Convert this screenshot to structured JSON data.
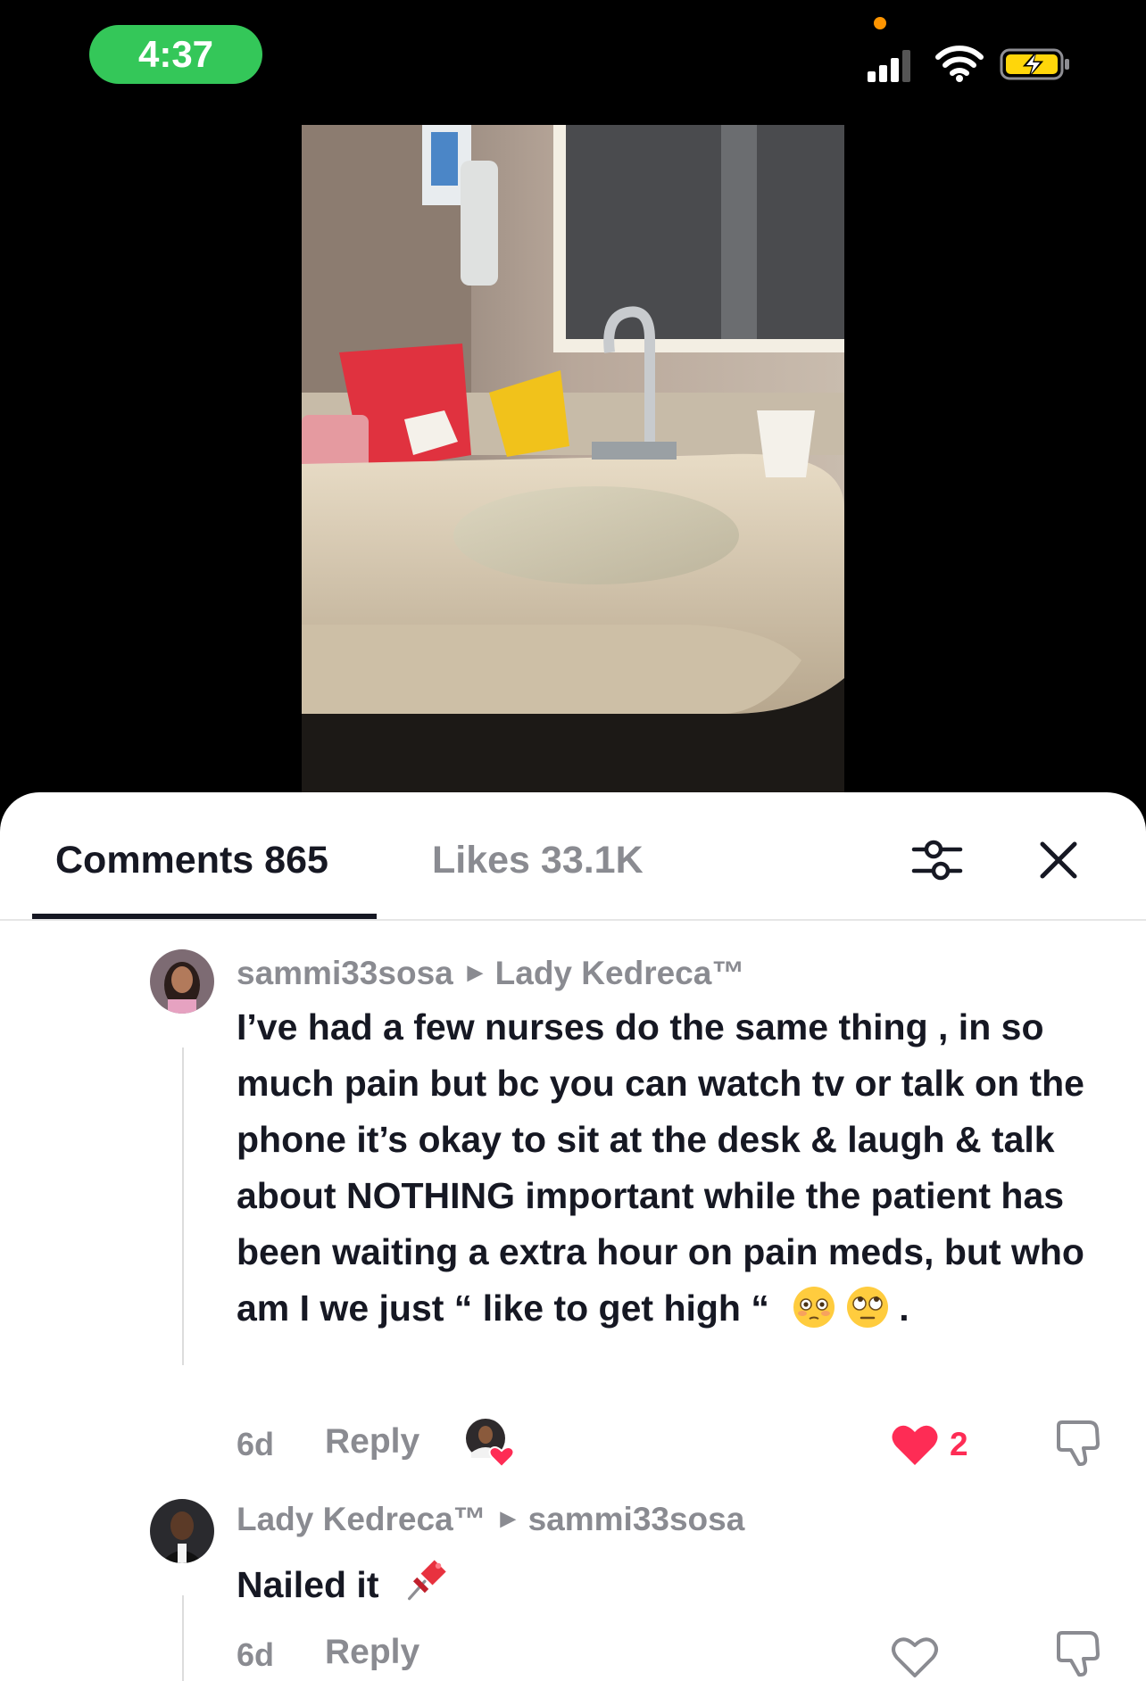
{
  "status_bar": {
    "time": "4:37",
    "icons": [
      "privacy-dot",
      "cellular-signal-icon",
      "wifi-icon",
      "battery-charging-icon"
    ],
    "colors": {
      "time_pill": "#34c759",
      "privacy_dot": "#ff9500",
      "battery": "#ffd60a"
    }
  },
  "video": {
    "description_icon": "bathroom-sink-overflowing-photo"
  },
  "tabs": {
    "comments_label": "Comments 865",
    "likes_label": "Likes 33.1K",
    "filter_icon": "sliders-icon",
    "close_icon": "close-icon"
  },
  "comments": [
    {
      "author": "sammi33sosa",
      "reply_to": "Lady Kedreca™",
      "text": "I’ve had a few nurses do the same thing , in so much pain but bc you can watch tv or talk on the phone it’s okay to sit at the desk & laugh & talk about NOTHING important while the patient has been waiting a extra hour on pain meds, but who am I we just “ like to get high “",
      "emojis": [
        "flushed-face-emoji",
        "eye-roll-emoji"
      ],
      "trailing": ".",
      "time": "6d",
      "reply_label": "Reply",
      "creator_liked": true,
      "liked": true,
      "likes": "2"
    },
    {
      "author": "Lady Kedreca™",
      "reply_to": "sammi33sosa",
      "text": "Nailed it",
      "emojis": [
        "pushpin-emoji"
      ],
      "time": "6d",
      "reply_label": "Reply",
      "liked": false
    }
  ],
  "accent_color": "#fe2c55"
}
